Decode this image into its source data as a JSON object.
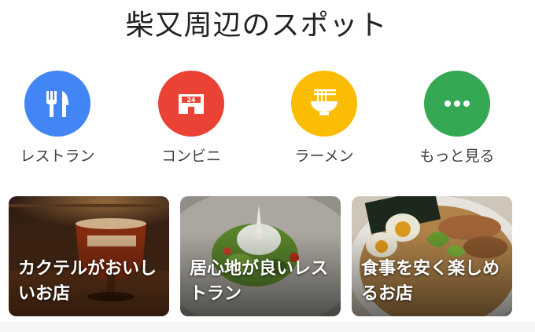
{
  "page": {
    "title": "柴又周辺のスポット"
  },
  "categories": [
    {
      "label": "レストラン",
      "icon": "restaurant-icon",
      "color": "#4285f4"
    },
    {
      "label": "コンビニ",
      "icon": "convenience-store-icon",
      "color": "#ea4335"
    },
    {
      "label": "ラーメン",
      "icon": "ramen-icon",
      "color": "#fbbc04"
    },
    {
      "label": "もっと見る",
      "icon": "more-icon",
      "color": "#34a853"
    }
  ],
  "cards": [
    {
      "title": "カクテルがおいしいお店",
      "image": "cocktail-bar-photo"
    },
    {
      "title": "居心地が良いレストラン",
      "image": "salad-plate-photo"
    },
    {
      "title": "食事を安く楽しめるお店",
      "image": "ramen-bowl-photo"
    }
  ]
}
